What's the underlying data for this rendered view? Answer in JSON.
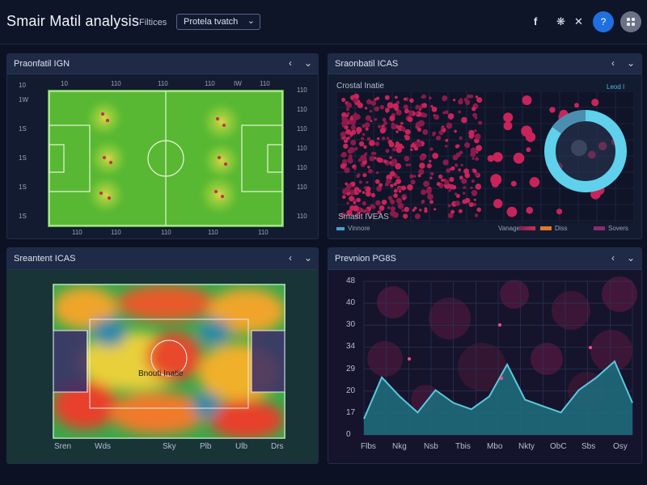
{
  "header": {
    "title": "Smair Matil analysis",
    "filters_label": "Filtices",
    "match_select": "Protela tvatch",
    "icons": [
      "facebook-icon",
      "settings-icon",
      "close-icon",
      "help-icon",
      "apps-icon"
    ]
  },
  "panels": {
    "top_left": {
      "title": "Praonfatil IGN",
      "top_ticks": [
        "10",
        "110",
        "110",
        "110",
        "IW",
        "110"
      ],
      "bottom_ticks": [
        "110",
        "110",
        "110",
        "110",
        "110"
      ],
      "left_ticks": [
        "10",
        "1W",
        "1S",
        "1S",
        "1S",
        "1S"
      ],
      "right_ticks": [
        "110",
        "110",
        "110",
        "110",
        "110",
        "110",
        "110"
      ]
    },
    "top_right": {
      "title": "Sraonbatil ICAS",
      "chart_label": "Crostal Inatie",
      "corner_label": "Leod I",
      "inner_label": "Smasit IVEAS",
      "legend": [
        "Vinnore",
        "Vanaget",
        "Diss",
        "Sovers"
      ]
    },
    "bottom_left": {
      "title": "Sreantent ICAS",
      "center_label": "Bnouti Inatie",
      "x_ticks": [
        "Sren",
        "Wds",
        "Sky",
        "Plb",
        "Ulb",
        "Drs"
      ]
    },
    "bottom_right": {
      "title": "Prevnion PG8S",
      "y_ticks": [
        "48",
        "40",
        "30",
        "34",
        "29",
        "20",
        "17",
        "0"
      ],
      "x_ticks": [
        "Flbs",
        "Nkg",
        "Nsb",
        "Tbis",
        "Mbo",
        "Nkty",
        "ObC",
        "Sbs",
        "Osy"
      ]
    }
  },
  "chart_data": {
    "type": "area",
    "categories": [
      "Flbs",
      "Nkg",
      "Nsb",
      "Tbis",
      "Mbo",
      "Nkty",
      "ObC",
      "Sbs",
      "Osy"
    ],
    "series": [
      {
        "values": [
          5,
          18,
          12,
          7,
          14,
          10,
          8,
          12,
          22,
          11,
          9,
          7,
          14,
          18,
          23,
          10
        ]
      }
    ],
    "y_tick_labels": [
      "48",
      "40",
      "30",
      "34",
      "29",
      "20",
      "17",
      "0"
    ],
    "ylim": [
      0,
      48
    ],
    "grid": true
  }
}
